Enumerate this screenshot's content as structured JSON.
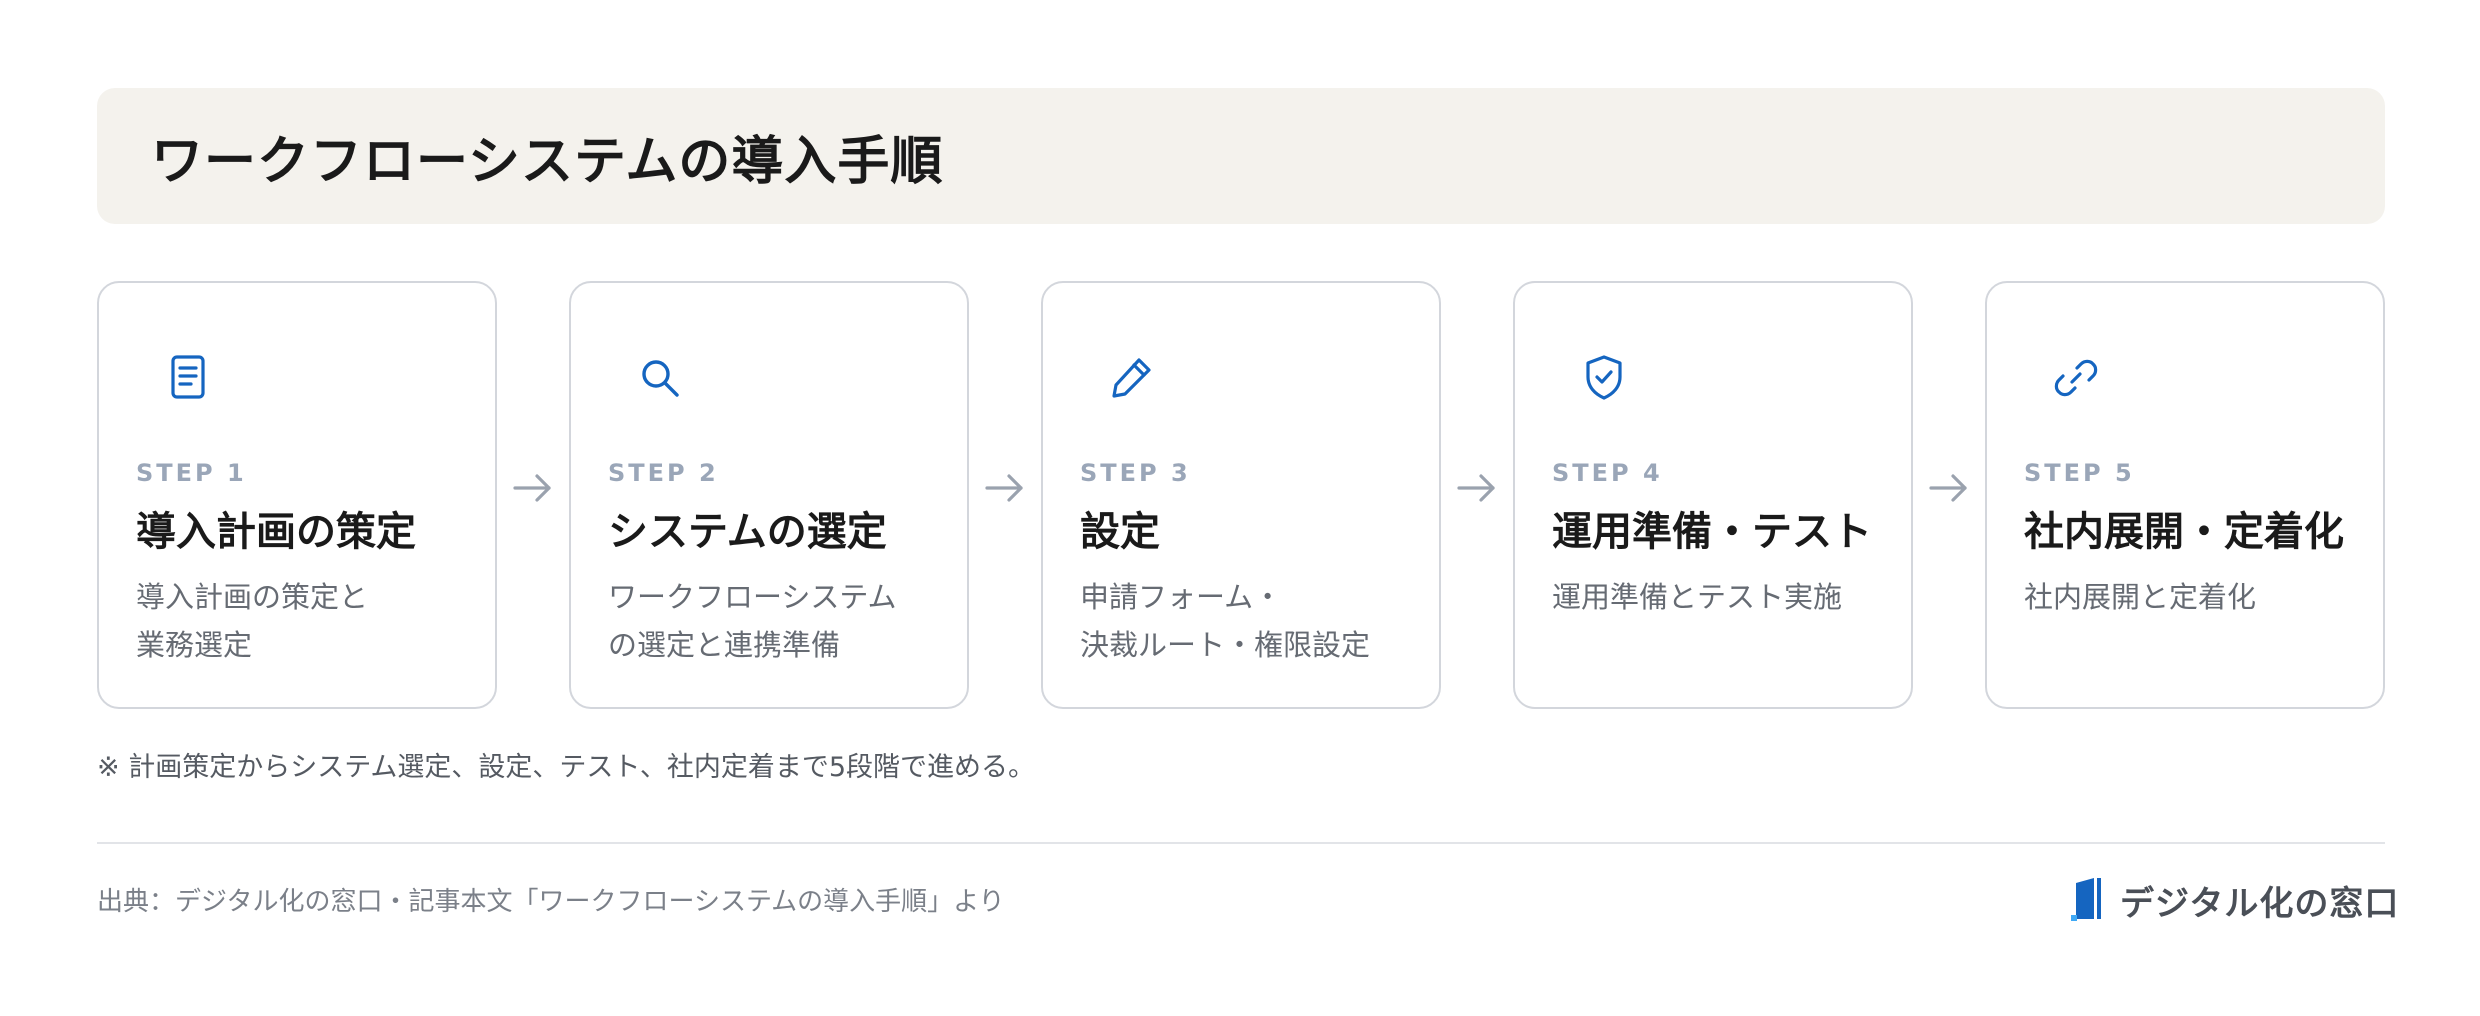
{
  "title": "ワークフローシステムの導入手順",
  "steps": [
    {
      "label": "STEP 1",
      "title": "導入計画の策定",
      "desc": "導入計画の策定と\n業務選定",
      "icon": "document-icon"
    },
    {
      "label": "STEP 2",
      "title": "システムの選定",
      "desc": "ワークフローシステム\nの選定と連携準備",
      "icon": "search-icon"
    },
    {
      "label": "STEP 3",
      "title": "設定",
      "desc": "申請フォーム・\n決裁ルート・権限設定",
      "icon": "pencil-icon"
    },
    {
      "label": "STEP 4",
      "title": "運用準備・テスト",
      "desc": "運用準備とテスト実施",
      "icon": "shield-check-icon"
    },
    {
      "label": "STEP 5",
      "title": "社内展開・定着化",
      "desc": "社内展開と定着化",
      "icon": "link-icon"
    }
  ],
  "note": "※ 計画策定からシステム選定、設定、テスト、社内定着まで5段階で進める。",
  "source": "出典：デジタル化の窓口・記事本文「ワークフローシステムの導入手順」より",
  "logo": {
    "text": "デジタル化の窓口",
    "icon": "logo-mark-icon"
  },
  "colors": {
    "accent": "#1565c0",
    "title_bg": "#f4f2ed",
    "card_border": "#d3d6dc",
    "step_label": "#9aa6b8",
    "arrow": "#9aa2ae"
  }
}
